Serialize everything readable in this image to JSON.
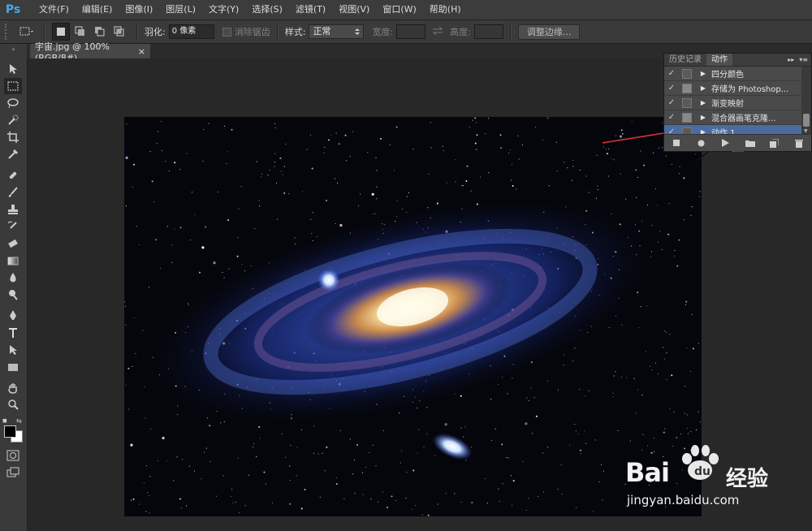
{
  "app": {
    "logo": "Ps"
  },
  "menu": [
    "文件(F)",
    "编辑(E)",
    "图像(I)",
    "图层(L)",
    "文字(Y)",
    "选择(S)",
    "滤镜(T)",
    "视图(V)",
    "窗口(W)",
    "帮助(H)"
  ],
  "options": {
    "feather_label": "羽化:",
    "feather_value": "0 像素",
    "antialias_label": "消除锯齿",
    "style_label": "样式:",
    "style_value": "正常",
    "width_label": "宽度:",
    "height_label": "高度:",
    "refine_button": "调整边缘..."
  },
  "document": {
    "tab_title": "宇宙.jpg @ 100%(RGB/8#)",
    "close": "×"
  },
  "panel": {
    "tabs": [
      "历史记录",
      "动作"
    ],
    "active_tab": 1,
    "actions": [
      {
        "label": "四分颜色",
        "checked": true
      },
      {
        "label": "存储为 Photoshop...",
        "checked": true
      },
      {
        "label": "渐变映射",
        "checked": true
      },
      {
        "label": "混合器画笔克隆...",
        "checked": true
      },
      {
        "label": "动作 1",
        "checked": true,
        "selected": true
      }
    ],
    "footer_icons": [
      "stop-icon",
      "record-icon",
      "play-icon",
      "new-set-icon",
      "new-action-icon",
      "delete-icon"
    ]
  },
  "watermark": {
    "brand": "Bai",
    "brand2": "经验",
    "url": "jingyan.baidu.com"
  },
  "colors": {
    "accent": "#4a6ca0",
    "logo": "#48a7e8",
    "annotation": "#e0303a"
  }
}
